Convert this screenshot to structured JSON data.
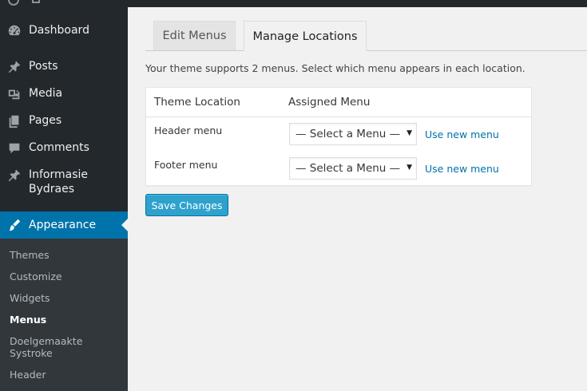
{
  "sidebar": {
    "items": [
      {
        "label": "Dashboard",
        "icon": "dashboard-icon"
      },
      {
        "label": "Posts",
        "icon": "pin-icon"
      },
      {
        "label": "Media",
        "icon": "media-icon"
      },
      {
        "label": "Pages",
        "icon": "pages-icon"
      },
      {
        "label": "Comments",
        "icon": "comment-icon"
      },
      {
        "label": "Informasie Bydraes",
        "icon": "pin-icon"
      }
    ],
    "active": {
      "label": "Appearance",
      "icon": "brush-icon"
    },
    "submenu": [
      "Themes",
      "Customize",
      "Widgets",
      "Menus",
      "Doelgemaakte Systroke",
      "Header"
    ],
    "current_submenu": "Menus"
  },
  "tabs": {
    "edit_menus": "Edit Menus",
    "manage_locations": "Manage Locations"
  },
  "description": "Your theme supports 2 menus. Select which menu appears in each location.",
  "table": {
    "col_location": "Theme Location",
    "col_assigned": "Assigned Menu",
    "rows": [
      {
        "location": "Header menu",
        "selected": "— Select a Menu —",
        "link": "Use new menu"
      },
      {
        "location": "Footer menu",
        "selected": "— Select a Menu —",
        "link": "Use new menu"
      }
    ]
  },
  "save_button": "Save Changes",
  "colors": {
    "sidebar_bg": "#23282d",
    "submenu_bg": "#32373c",
    "accent": "#0073aa",
    "button": "#2ea2cc",
    "page_bg": "#f1f1f1"
  }
}
